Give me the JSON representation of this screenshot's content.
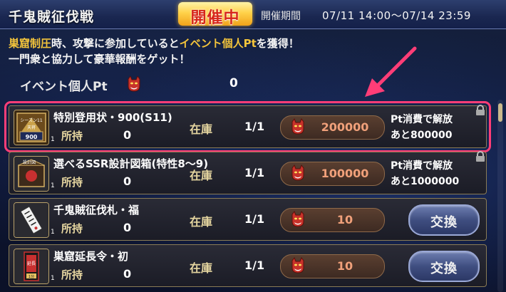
{
  "header": {
    "title": "千鬼賊征伐戦",
    "badge": "開催中",
    "period_label": "開催期間",
    "period_value": "07/11 14:00〜07/14 23:59"
  },
  "description": {
    "line1_a": "巣窟制圧",
    "line1_b": "時、攻撃に参加していると",
    "line1_c": "イベント個人Pt",
    "line1_d": "を獲得！",
    "line2": "一門衆と協力して豪華報酬をゲット！"
  },
  "points": {
    "label": "イベント個人Pt",
    "value": "0",
    "icon": "oni-mask-icon"
  },
  "labels": {
    "held": "所持",
    "stock": "在庫",
    "unlock_line1": "Pt消費で解放",
    "exchange": "交換"
  },
  "rewards": [
    {
      "name": "特別登用状・900(S11)",
      "held": "0",
      "stock": "1/1",
      "price": "200000",
      "unlock_remaining": "あと800000",
      "locked": true,
      "icon_text": "シーズン11 天将 900",
      "count": "1"
    },
    {
      "name": "選べるSSR設計図箱(特性8〜9)",
      "held": "0",
      "stock": "1/1",
      "price": "100000",
      "unlock_remaining": "あと1000000",
      "locked": true,
      "icon_text": "設計図",
      "count": "1"
    },
    {
      "name": "千鬼賊征伐札・福",
      "held": "0",
      "stock": "1/1",
      "price": "10",
      "locked": false,
      "icon_text": "",
      "count": "1"
    },
    {
      "name": "巣窟延長令・初",
      "held": "0",
      "stock": "1/1",
      "price": "10",
      "locked": false,
      "icon_text": "延長 1分",
      "count": "1"
    }
  ],
  "colors": {
    "highlight_outline": "#ff3d77",
    "accent_gold": "#f3c43b",
    "price_text": "#f0a07a"
  }
}
